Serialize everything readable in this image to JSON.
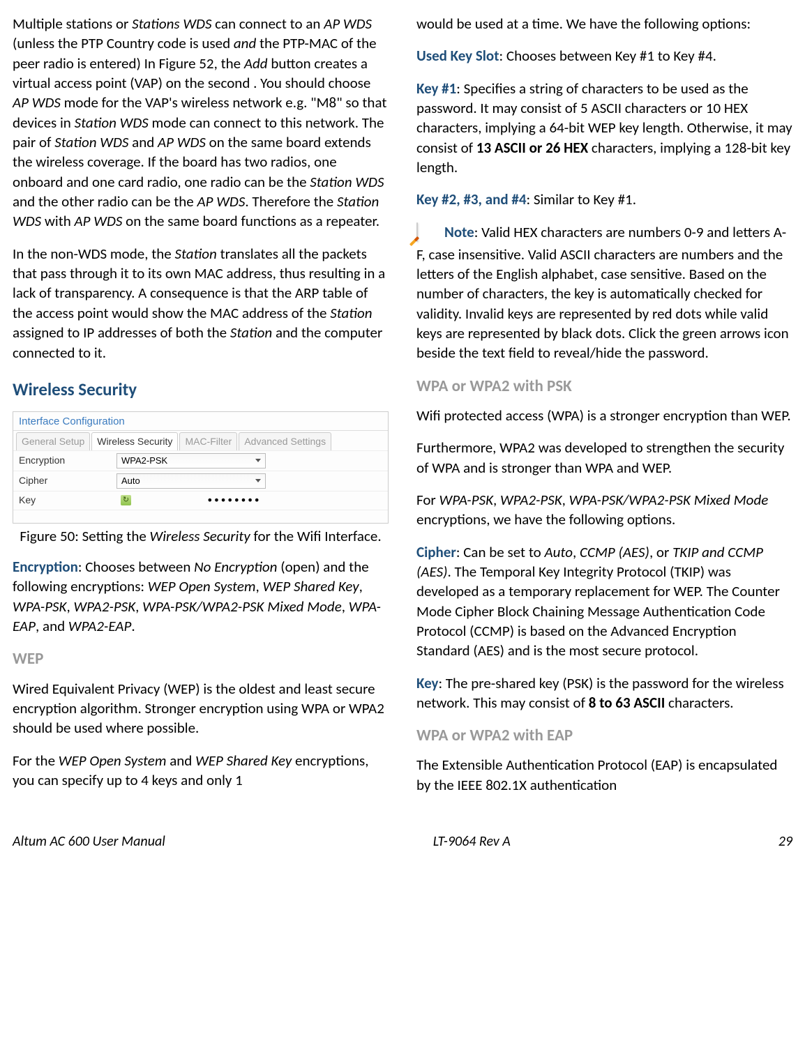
{
  "col1": {
    "p1_parts": [
      {
        "t": "Multiple stations or "
      },
      {
        "t": "Stations WDS",
        "i": true
      },
      {
        "t": " can connect to an "
      },
      {
        "t": "AP WDS",
        "i": true
      },
      {
        "t": " (unless the PTP Country code is used "
      },
      {
        "t": "and",
        "i": true
      },
      {
        "t": " the PTP-MAC of the peer radio is entered) In Figure 52, the "
      },
      {
        "t": "Add",
        "i": true
      },
      {
        "t": " button creates a virtual access point (VAP) on the second . You should choose "
      },
      {
        "t": "AP WDS",
        "i": true
      },
      {
        "t": " mode for the VAP's wireless network e.g. \"M8\" so that devices in "
      },
      {
        "t": "Station WDS",
        "i": true
      },
      {
        "t": " mode can connect to this network. The pair of "
      },
      {
        "t": "Station WDS",
        "i": true
      },
      {
        "t": " and "
      },
      {
        "t": "AP WDS",
        "i": true
      },
      {
        "t": " on the same board extends the wireless coverage. If the board has two radios, one onboard and one card radio, one radio can be the "
      },
      {
        "t": "Station WDS",
        "i": true
      },
      {
        "t": " and the other radio can be the "
      },
      {
        "t": "AP WDS",
        "i": true
      },
      {
        "t": ". Therefore the "
      },
      {
        "t": "Station WDS",
        "i": true
      },
      {
        "t": " with "
      },
      {
        "t": "AP WDS",
        "i": true
      },
      {
        "t": " on the same board functions as a repeater."
      }
    ],
    "p2_parts": [
      {
        "t": "In the non-WDS mode, the "
      },
      {
        "t": "Station",
        "i": true
      },
      {
        "t": " translates all the packets that pass through it to its own MAC address, thus resulting in a lack of transparency. A consequence is that the ARP table of the access point would show the MAC address of the "
      },
      {
        "t": "Station",
        "i": true
      },
      {
        "t": " assigned to IP addresses of both the "
      },
      {
        "t": "Station",
        "i": true
      },
      {
        "t": " and the computer connected to it."
      }
    ],
    "h2_wireless": "Wireless Security",
    "figure": {
      "legend": "Interface Configuration",
      "tabs": [
        "General Setup",
        "Wireless Security",
        "MAC-Filter",
        "Advanced Settings"
      ],
      "active_tab_index": 1,
      "rows": {
        "encryption": {
          "label": "Encryption",
          "value": "WPA2-PSK"
        },
        "cipher": {
          "label": "Cipher",
          "value": "Auto"
        },
        "key": {
          "label": "Key",
          "value": "••••••••"
        }
      }
    },
    "fig_caption_parts": [
      {
        "t": "Figure 50: Setting the "
      },
      {
        "t": "Wireless Security",
        "i": true
      },
      {
        "t": " for the Wifi Interface."
      }
    ],
    "encryption_parts": [
      {
        "t": "Encryption",
        "cls": "blue-label"
      },
      {
        "t": ": Chooses between "
      },
      {
        "t": "No Encryption",
        "i": true
      },
      {
        "t": " (open) and the following encryptions: "
      },
      {
        "t": "WEP Open System",
        "i": true
      },
      {
        "t": ", "
      },
      {
        "t": "WEP Shared Key",
        "i": true
      },
      {
        "t": ", "
      },
      {
        "t": "WPA-PSK",
        "i": true
      },
      {
        "t": ", "
      },
      {
        "t": "WPA2-PSK",
        "i": true
      },
      {
        "t": ", "
      },
      {
        "t": "WPA-PSK/WPA2-PSK Mixed Mode",
        "i": true
      },
      {
        "t": ", "
      },
      {
        "t": "WPA-EAP",
        "i": true
      },
      {
        "t": ", and "
      },
      {
        "t": "WPA2-EAP",
        "i": true
      },
      {
        "t": "."
      }
    ],
    "h3_wep": "WEP",
    "wep_p1": "Wired Equivalent Privacy (WEP) is the oldest and least secure encryption algorithm. Stronger encryption using WPA or WPA2 should be used where possible.",
    "wep_p2_parts": [
      {
        "t": "For the "
      },
      {
        "t": "WEP Open System",
        "i": true
      },
      {
        "t": " and "
      },
      {
        "t": "WEP Shared Key",
        "i": true
      },
      {
        "t": " encryptions, you can specify up to 4 keys and only 1 "
      }
    ]
  },
  "col2": {
    "p1": "would be used at a time. We have the following options:",
    "used_key_parts": [
      {
        "t": "Used Key Slot",
        "cls": "blue-label"
      },
      {
        "t": ": Chooses between Key #1 to Key #4."
      }
    ],
    "key1_parts": [
      {
        "t": "Key #1",
        "cls": "blue-label"
      },
      {
        "t": ": Specifies a string of characters to be used as the password. It may consist of 5 ASCII characters or 10 HEX characters, implying a 64-bit WEP key length. Otherwise, it may consist of "
      },
      {
        "t": "13 ASCII or 26 HEX",
        "b": true
      },
      {
        "t": " characters, implying a 128-bit key length."
      }
    ],
    "key234_parts": [
      {
        "t": "Key #2, #3, and #4",
        "cls": "blue-label"
      },
      {
        "t": ": Similar to Key #1."
      }
    ],
    "note_parts": [
      {
        "t": "Note",
        "cls": "blue-label"
      },
      {
        "t": ": Valid HEX characters are numbers 0-9 and letters A-F, case insensitive. Valid ASCII characters are numbers and the letters of the English alphabet, case sensitive. Based on the number of characters, the key is automatically checked for validity. Invalid keys are represented by red dots while valid keys are represented by black dots. Click the green arrows icon beside the text field to reveal/hide the password."
      }
    ],
    "h3_wpa_psk": "WPA or WPA2 with PSK",
    "wpa_p1": "Wifi protected access (WPA) is a stronger encryption than WEP.",
    "wpa_p2": "Furthermore, WPA2 was developed to strengthen the security of WPA and is stronger than WPA and WEP.",
    "wpa_p3_parts": [
      {
        "t": "For "
      },
      {
        "t": "WPA-PSK",
        "i": true
      },
      {
        "t": ", "
      },
      {
        "t": "WPA2-PSK",
        "i": true
      },
      {
        "t": ", "
      },
      {
        "t": "WPA-PSK/WPA2-PSK Mixed Mode",
        "i": true
      },
      {
        "t": " encryptions, we have the following options."
      }
    ],
    "cipher_parts": [
      {
        "t": "Cipher",
        "cls": "blue-label"
      },
      {
        "t": ": Can be set to "
      },
      {
        "t": "Auto",
        "i": true
      },
      {
        "t": ", "
      },
      {
        "t": "CCMP (AES)",
        "i": true
      },
      {
        "t": ", or "
      },
      {
        "t": "TKIP and CCMP (AES)",
        "i": true
      },
      {
        "t": ". The Temporal Key Integrity Protocol (TKIP) was developed as a temporary replacement for WEP. The Counter Mode Cipher Block Chaining Message Authentication Code Protocol (CCMP) is based on the Advanced Encryption Standard (AES) and is the most secure protocol."
      }
    ],
    "key_parts": [
      {
        "t": "Key",
        "cls": "blue-label"
      },
      {
        "t": ": The pre-shared key (PSK) is the password for the wireless network. This may consist of "
      },
      {
        "t": "8 to 63 ASCII",
        "b": true
      },
      {
        "t": " characters."
      }
    ],
    "h3_wpa_eap": "WPA or WPA2 with EAP",
    "eap_p1": "The Extensible Authentication Protocol (EAP) is encapsulated by the IEEE 802.1X authentication"
  },
  "footer": {
    "left": "Altum AC 600 User Manual",
    "center": "LT-9064 Rev A",
    "right": "29"
  }
}
